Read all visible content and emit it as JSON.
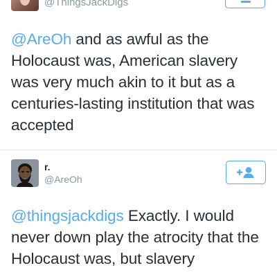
{
  "tweet1": {
    "handle": "@ThingsJackDigs",
    "mention": "@AreOh",
    "text": " and as awful as the Holocaust was, American slavery was very much akin to it but as a centuries-lasting institution that was accepted"
  },
  "tweet2": {
    "name": "r.",
    "handle": "@AreOh",
    "mention": "@thingsjackdigs",
    "text": " Exactly. I would never down play the atrocity that the Holocaust was, but slavery"
  },
  "icons": {
    "follow": "add-user-icon"
  },
  "colors": {
    "accent": "#55acee",
    "text": "#292f33",
    "muted": "#8899a6"
  }
}
